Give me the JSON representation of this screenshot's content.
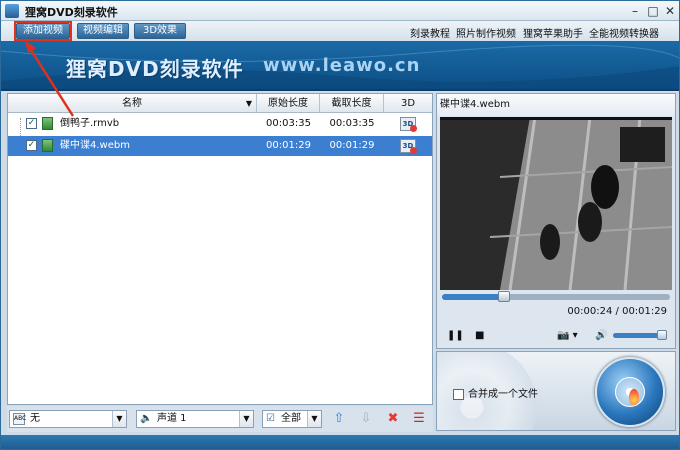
{
  "window": {
    "title": "狸窝DVD刻录软件"
  },
  "toolbar": {
    "add_video": "添加视频",
    "video_edit": "视频编辑",
    "effect_3d": "3D效果",
    "links": [
      "刻录教程",
      "照片制作视频",
      "狸窝苹果助手",
      "全能视频转换器"
    ]
  },
  "banner": {
    "title": "狸窝DVD刻录软件",
    "url": "www.leawo.cn"
  },
  "file_list": {
    "columns": [
      "名称",
      "原始长度",
      "截取长度",
      "3D"
    ],
    "rows": [
      {
        "name": "倒鸭子.rmvb",
        "original": "00:03:35",
        "clip": "00:03:35",
        "checked": true,
        "selected": false
      },
      {
        "name": "碟中谍4.webm",
        "original": "00:01:29",
        "clip": "00:01:29",
        "checked": true,
        "selected": true
      }
    ]
  },
  "bottom": {
    "subtitle_combo": "无",
    "audio_combo": "声道 1",
    "all_combo": "全部"
  },
  "preview": {
    "title": "碟中谍4.webm",
    "time_current": "00:00:24",
    "time_sep": "/",
    "time_total": "00:01:29",
    "progress_fraction": 0.27,
    "volume_fraction": 0.9
  },
  "burn": {
    "merge_label": "合并成一个文件"
  },
  "colors": {
    "accent": "#3c7fd1",
    "highlight": "#e0301e"
  }
}
